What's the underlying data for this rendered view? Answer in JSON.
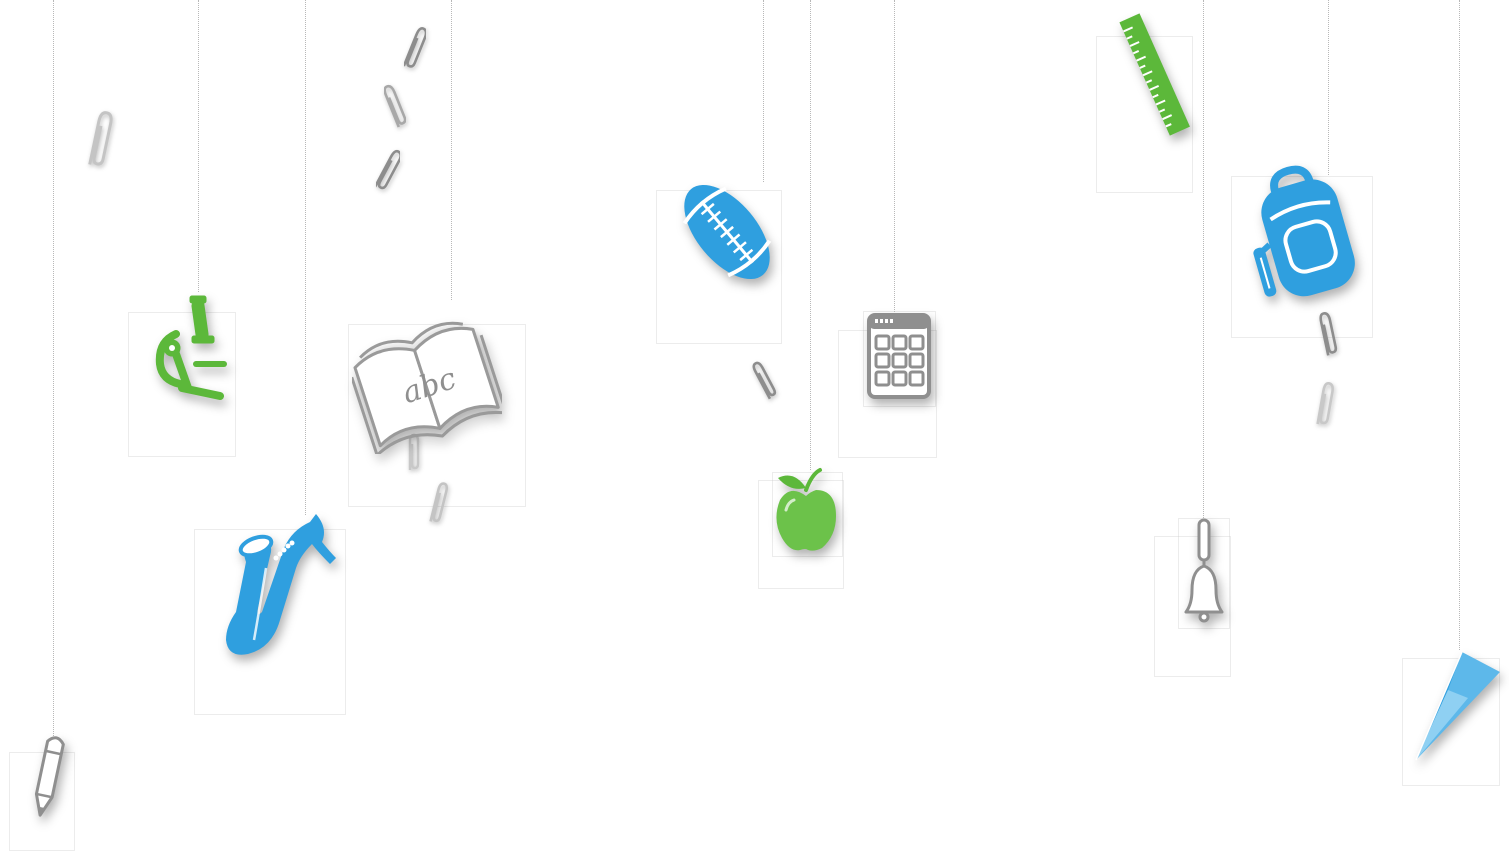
{
  "scene": {
    "background_color": "#ffffff",
    "string_color": "#b8b8b8",
    "accent_colors": {
      "blue": "#2f9fdf",
      "green": "#5cb83a",
      "gray": "#8f8f8f"
    }
  },
  "ornaments": [
    {
      "icon": "pencil-icon",
      "color": "#8f8f8f"
    },
    {
      "icon": "microscope-icon",
      "color": "#5cb83a"
    },
    {
      "icon": "saxophone-icon",
      "color": "#2f9fdf"
    },
    {
      "icon": "open-book-icon",
      "color": "#8f8f8f",
      "text": "abc"
    },
    {
      "icon": "football-icon",
      "color": "#2f9fdf"
    },
    {
      "icon": "apple-icon",
      "color": "#5cb83a"
    },
    {
      "icon": "calculator-icon",
      "color": "#8f8f8f"
    },
    {
      "icon": "ruler-icon",
      "color": "#5cb83a"
    },
    {
      "icon": "bell-icon",
      "color": "#8f8f8f"
    },
    {
      "icon": "backpack-icon",
      "color": "#2f9fdf"
    },
    {
      "icon": "paper-plane-icon",
      "color": "#2f9fdf"
    },
    {
      "icon": "paperclip-icon",
      "color": "#b0b0b0"
    }
  ]
}
